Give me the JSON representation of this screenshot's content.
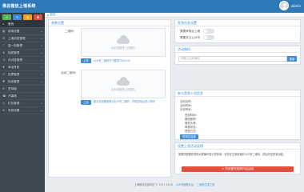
{
  "app": {
    "brand": "佛总微信上墙系统",
    "user_name": "admin"
  },
  "sidebar": {
    "tools": [
      "✔",
      "✎",
      "★",
      "✖"
    ],
    "items": [
      {
        "icon": "⌂",
        "label": "首页",
        "caret": ""
      },
      {
        "icon": "▦",
        "label": "现场设置",
        "caret": "▸"
      },
      {
        "icon": "☰",
        "label": "上墙消息管理",
        "caret": "▸"
      },
      {
        "icon": "♪",
        "label": "摇一摇管理",
        "caret": "▸"
      },
      {
        "icon": "♛",
        "label": "抽奖管理",
        "caret": "▸"
      },
      {
        "icon": "☺",
        "label": "对对碰管理",
        "caret": "▸"
      },
      {
        "icon": "✚",
        "label": "幸运号码",
        "caret": "▸"
      },
      {
        "icon": "☷",
        "label": "投票管理",
        "caret": "▸"
      },
      {
        "icon": "♥",
        "label": "相亲管理",
        "caret": "▸"
      },
      {
        "icon": "✉",
        "label": "签到墙",
        "caret": ""
      },
      {
        "icon": "☎",
        "label": "开幕墙",
        "caret": ""
      },
      {
        "icon": "◎",
        "label": "红包管理",
        "caret": "▸"
      },
      {
        "icon": "⚙",
        "label": "系统设置",
        "caret": "▸"
      }
    ]
  },
  "breadcrumb": {
    "home": "首页"
  },
  "left_panel": {
    "title": "参数设置",
    "qr_label": "二维码：",
    "upload1_text": "点击或拖拽上传图片",
    "upload1_button": "上传",
    "upload1_hint": "公众号二维码尺寸要求150x150",
    "qr2_label": "活动二维码：",
    "upload2_text": "点击或拖拽上传图片",
    "upload2_button": "上传",
    "upload2_hint": "若为空则使用默认公众号二维码，手机扫码后进入现场"
  },
  "right_top": {
    "title": "签到任务设置",
    "switch1": "需要审核后上墙",
    "switch2": "需要关注公众号",
    "toggle_text": "OFF"
  },
  "right_search": {
    "title": "活动微码",
    "placeholder": "请输入活动微码",
    "button": "搜索"
  },
  "right_info": {
    "title": "参与签到人员信息",
    "lines": [
      "活动名称：",
      "活动时间：",
      "手机号码：",
      "签到时间：",
      "微信昵称：",
      "微信头像：",
      "审核状态：",
      "签到方式："
    ],
    "button": "签到并选择"
  },
  "right_notice": {
    "title": "设置上墙活动说明",
    "text": "如果您需要在现场大屏幕中显示签到墙，请先在左侧设置好公众号二维码，然后开启签到功能。",
    "button": "⚠ 先设置完成再开启活动"
  },
  "footer": {
    "copyright": "上海畅宇信息科技 © 2017-2018",
    "link1": "公众号管理平台",
    "link2": "二维码生成工具"
  }
}
